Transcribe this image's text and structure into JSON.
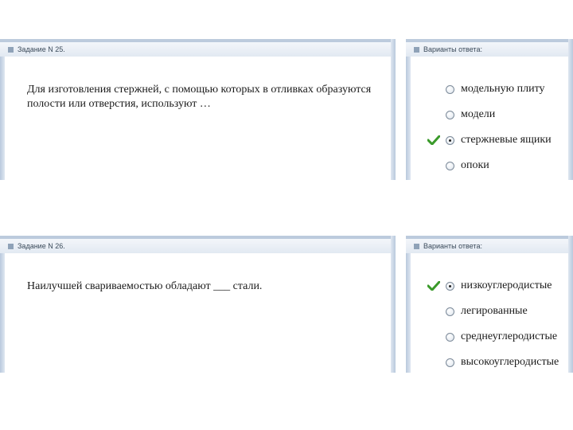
{
  "task25": {
    "header": "Задание N 25.",
    "question": "Для изготовления стержней, с помощью которых в отливках образуются полости или отверстия, используют …",
    "answers_header": "Варианты ответа:",
    "options": [
      {
        "label": "модельную плиту",
        "selected": false
      },
      {
        "label": "модели",
        "selected": false
      },
      {
        "label": "стержневые ящики",
        "selected": true
      },
      {
        "label": "опоки",
        "selected": false
      }
    ]
  },
  "task26": {
    "header": "Задание N 26.",
    "question": "Наилучшей свариваемостью обладают ___ стали.",
    "answers_header": "Варианты ответа:",
    "options": [
      {
        "label": "низкоуглеродистые",
        "selected": true
      },
      {
        "label": "легированные",
        "selected": false
      },
      {
        "label": "среднеуглеродистые",
        "selected": false
      },
      {
        "label": "высокоуглеродистые",
        "selected": false
      }
    ]
  },
  "colors": {
    "check": "#3a9a2a",
    "header_band": "#bccbdd"
  },
  "icons": {
    "header": "square-bullet-icon",
    "correct": "checkmark-icon",
    "choice": "radio-button-icon"
  }
}
